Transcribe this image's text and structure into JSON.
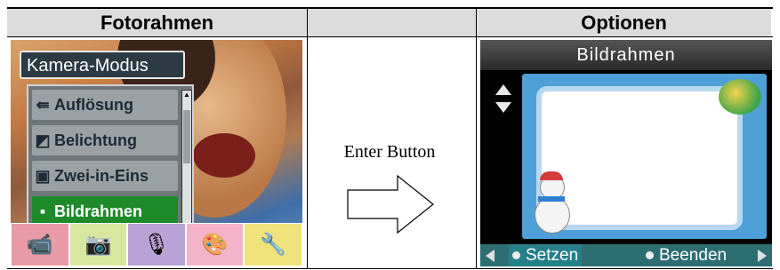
{
  "header": {
    "left_title": "Fotorahmen",
    "right_title": "Optionen"
  },
  "left_screen": {
    "menu_title": "Kamera-Modus",
    "items": [
      {
        "label": "Auflösung",
        "icon": "resolution-icon"
      },
      {
        "label": "Belichtung",
        "icon": "exposure-icon"
      },
      {
        "label": "Zwei-in-Eins",
        "icon": "two-in-one-icon"
      },
      {
        "label": "Bildrahmen",
        "icon": "photo-frame-icon",
        "selected": true
      }
    ],
    "mode_icons": [
      "video-camera-icon",
      "camera-icon",
      "microphone-icon",
      "palette-icon",
      "tools-icon"
    ],
    "mode_colors": [
      "#e89aa6",
      "#d8e7a0",
      "#b9a2d6",
      "#f3b3c8",
      "#f0e27a"
    ]
  },
  "middle": {
    "label": "Enter Button"
  },
  "right_screen": {
    "title": "Bildrahmen",
    "left_button": "Setzen",
    "right_button": "Beenden"
  },
  "colors": {
    "selection_green": "#1e8a2a",
    "bottom_bar": "#2d6e73",
    "header_bg": "#dcdcdc"
  }
}
